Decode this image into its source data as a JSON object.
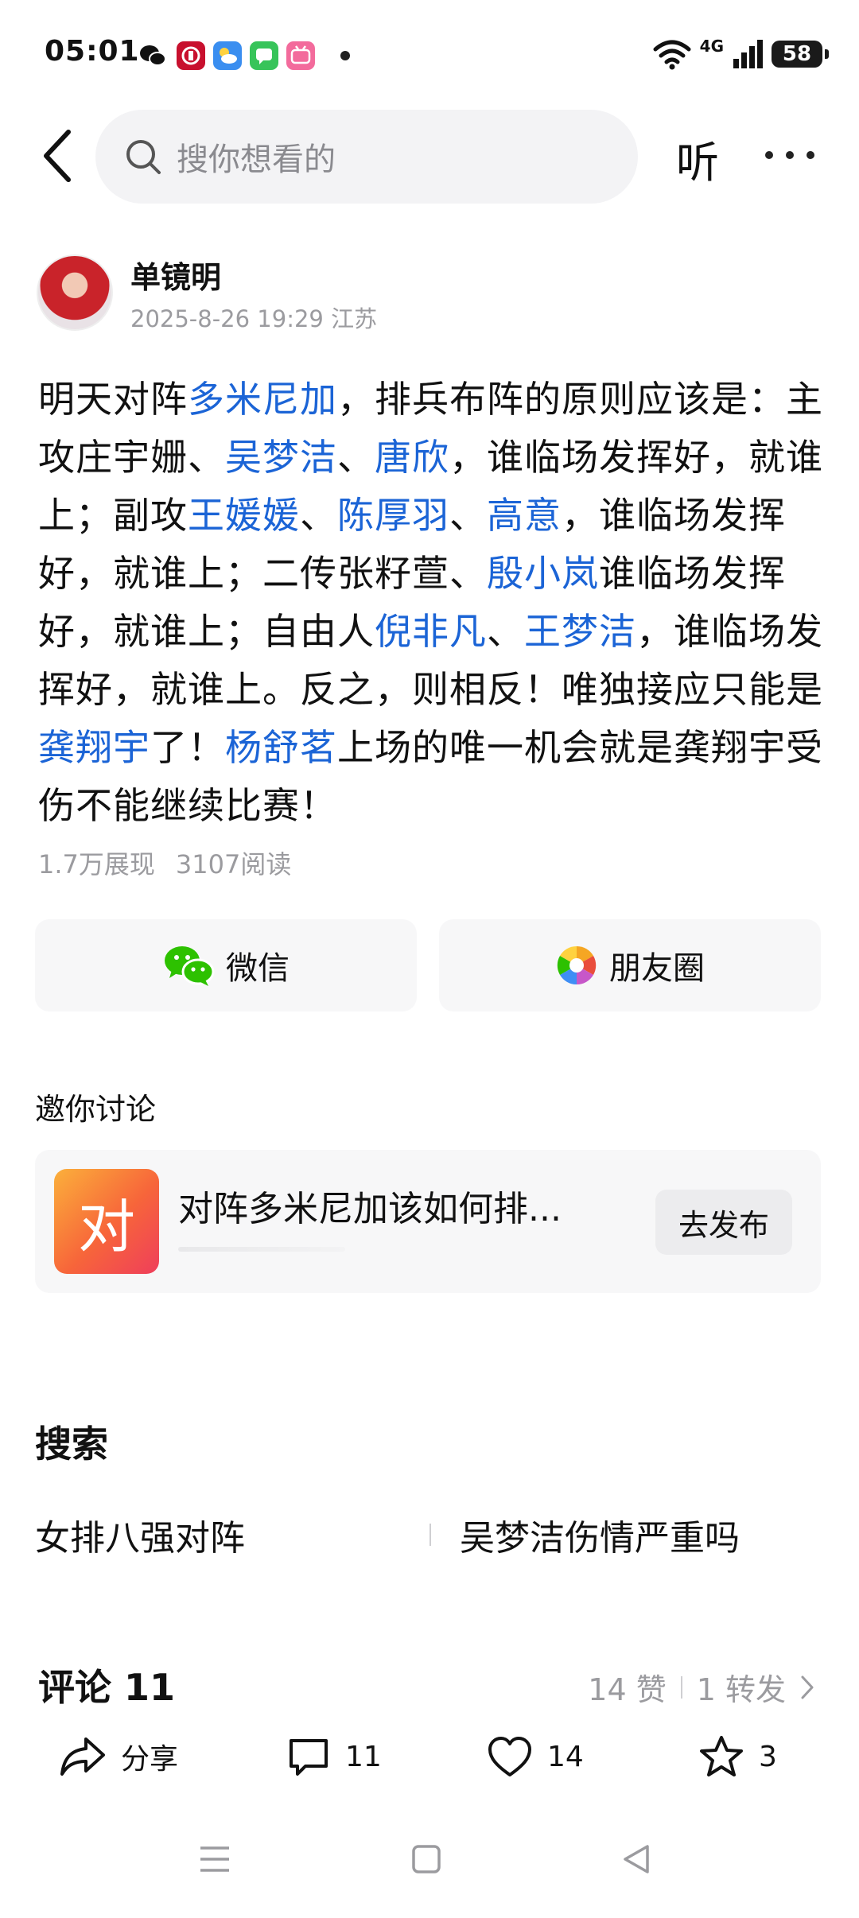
{
  "status_bar": {
    "time": "05:01",
    "network": "4G",
    "battery": "58"
  },
  "header": {
    "search_placeholder": "搜你想看的",
    "listen_label": "听"
  },
  "post": {
    "author_name": "单镜明",
    "meta": "2025-8-26 19:29 江苏",
    "segments": [
      {
        "text": "明天对阵",
        "link": false
      },
      {
        "text": "多米尼加",
        "link": true
      },
      {
        "text": "，排兵布阵的原则应该是：主攻庄宇姗、",
        "link": false
      },
      {
        "text": "吴梦洁",
        "link": true
      },
      {
        "text": "、",
        "link": false
      },
      {
        "text": "唐欣",
        "link": true
      },
      {
        "text": "，谁临场发挥好，就谁上；副攻",
        "link": false
      },
      {
        "text": "王媛媛",
        "link": true
      },
      {
        "text": "、",
        "link": false
      },
      {
        "text": "陈厚羽",
        "link": true
      },
      {
        "text": "、",
        "link": false
      },
      {
        "text": "高意",
        "link": true
      },
      {
        "text": "，谁临场发挥好，就谁上；二传张籽萱、",
        "link": false
      },
      {
        "text": "殷小岚",
        "link": true
      },
      {
        "text": "谁临场发挥好，就谁上；自由人",
        "link": false
      },
      {
        "text": "倪非凡",
        "link": true
      },
      {
        "text": "、",
        "link": false
      },
      {
        "text": "王梦洁",
        "link": true
      },
      {
        "text": "，谁临场发挥好，就谁上。反之，则相反！唯独接应只能是",
        "link": false
      },
      {
        "text": "龚翔宇",
        "link": true
      },
      {
        "text": "了！",
        "link": false
      },
      {
        "text": "杨舒茗",
        "link": true
      },
      {
        "text": "上场的唯一机会就是龚翔宇受伤不能继续比赛！",
        "link": false
      }
    ],
    "impressions": "1.7万展现",
    "reads": "3107阅读"
  },
  "share": {
    "wechat": "微信",
    "moments": "朋友圈"
  },
  "discussion": {
    "section_label": "邀你讨论",
    "icon_char": "对",
    "title": "对阵多米尼加该如何排...",
    "button": "去发布"
  },
  "search_section": {
    "heading": "搜索",
    "suggestions": [
      "女排八强对阵",
      "吴梦洁伤情严重吗"
    ]
  },
  "comments": {
    "heading": "评论 11",
    "likes": "14 赞",
    "reposts": "1 转发"
  },
  "actions": {
    "share": "分享",
    "comment_count": "11",
    "like_count": "14",
    "favorite_count": "3"
  },
  "colors": {
    "link": "#1b64d6",
    "muted": "#9b9b9f",
    "card_bg": "#f7f7f8"
  }
}
